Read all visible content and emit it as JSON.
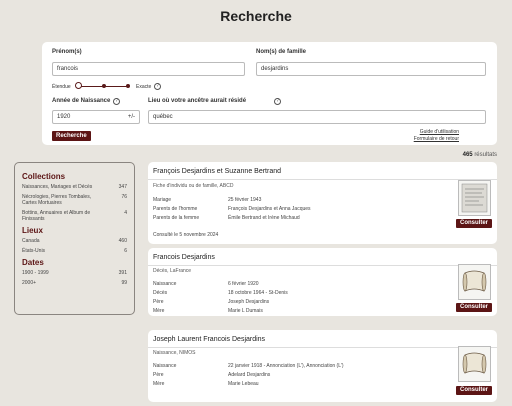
{
  "page": {
    "title": "Recherche"
  },
  "search": {
    "first_name_label": "Prénom(s)",
    "first_name_value": "francois",
    "last_name_label": "Nom(s) de famille",
    "last_name_value": "desjardins",
    "precision_left": "Étendue",
    "precision_right": "Exacte",
    "birth_year_label": "Année de Naissance",
    "birth_year_value": "1920",
    "birth_year_tolerance": "+/-",
    "place_label": "Lieu où votre ancêtre aurait résidé",
    "place_value": "québec",
    "search_button": "Recherche",
    "guide_link": "Guide d'utilisation",
    "feedback_link": "Formulaire de retour"
  },
  "results": {
    "count": "465",
    "count_label": "résultats"
  },
  "sidebar": {
    "collections_title": "Collections",
    "collections": [
      {
        "label": "Naissances, Mariages et Décès",
        "count": "347"
      },
      {
        "label": "Nécrologies, Pierres Tombales, Cartes Mortuaires",
        "count": "76"
      },
      {
        "label": "Bottins, Annuaires et Album de Finissants",
        "count": "4"
      }
    ],
    "places_title": "Lieux",
    "places": [
      {
        "label": "Canada",
        "count": "460"
      },
      {
        "label": "États-Unis",
        "count": "6"
      }
    ],
    "dates_title": "Dates",
    "dates": [
      {
        "label": "1900 - 1999",
        "count": "391"
      },
      {
        "label": "2000+",
        "count": "99"
      }
    ]
  },
  "cards": [
    {
      "title": "François Desjardins et Suzanne Bertrand",
      "subtitle": "Fiche d'individu ou de famille, ABCD",
      "fields": [
        {
          "k": "Mariage",
          "v": "25 février 1943"
        },
        {
          "k": "Parents de l'homme",
          "v": "François Desjardins et Anna Jacques"
        },
        {
          "k": "Parents de la femme",
          "v": "Émile Bertrand et Irène Michaud"
        }
      ],
      "note": "Consulté le 5 novembre 2024",
      "button": "Consulter",
      "thumb_icon": "document-scan-icon"
    },
    {
      "title": "Francois Desjardins",
      "subtitle": "Décès, LaFrance",
      "fields": [
        {
          "k": "Naissance",
          "v": "6 février 1920"
        },
        {
          "k": "Décès",
          "v": "18 octobre 1964 - St-Denis"
        },
        {
          "k": "Père",
          "v": "Joseph Desjardins"
        },
        {
          "k": "Mère",
          "v": "Marie L Dumais"
        }
      ],
      "button": "Consulter",
      "thumb_icon": "scroll-icon"
    },
    {
      "title": "Joseph Laurent Francois Desjardins",
      "subtitle": "Naissance, NIMOS",
      "fields": [
        {
          "k": "Naissance",
          "v": "22 janvier 1918 - Annonciation (L'), Annonciation (L')"
        },
        {
          "k": "Père",
          "v": "Adelard Desjardins"
        },
        {
          "k": "Mère",
          "v": "Marie Lebeau"
        }
      ],
      "button": "Consulter",
      "thumb_icon": "scroll-icon"
    }
  ],
  "colors": {
    "accent": "#5c1515",
    "background": "#e8e5df"
  }
}
